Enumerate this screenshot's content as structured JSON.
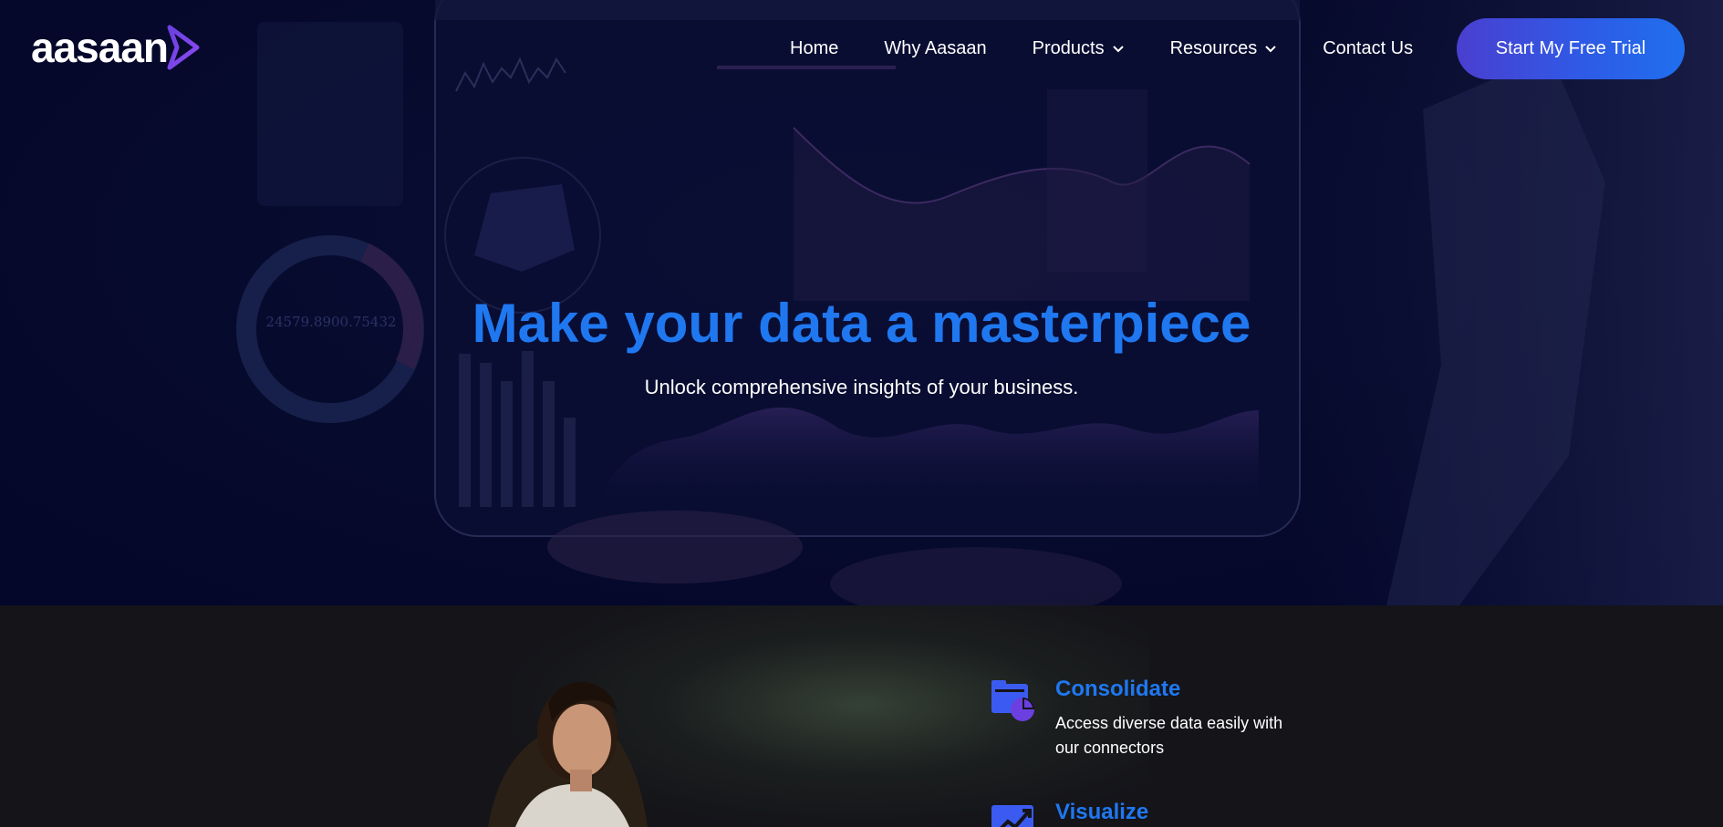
{
  "brand": {
    "logo_text": "aasaan"
  },
  "nav": {
    "items": [
      {
        "label": "Home"
      },
      {
        "label": "Why Aasaan"
      },
      {
        "label": "Products"
      },
      {
        "label": "Resources"
      },
      {
        "label": "Contact Us"
      }
    ],
    "cta_label": "Start My Free Trial"
  },
  "hero": {
    "title": "Make your data a masterpiece",
    "subtitle": "Unlock comprehensive insights of your business.",
    "background_readout": "24579.8900.75432"
  },
  "features": [
    {
      "title": "Consolidate",
      "description": "Access diverse data easily with our connectors",
      "icon": "folder-chart-icon"
    },
    {
      "title": "Visualize",
      "description": "",
      "icon": "trend-chart-icon"
    }
  ],
  "colors": {
    "accent_blue": "#1f78f0",
    "cta_gradient_start": "#4a3fcf",
    "cta_gradient_end": "#1f6fee",
    "hero_bg": "#060a2c",
    "features_bg": "#141419",
    "icon_purple": "#6b3fe0"
  }
}
